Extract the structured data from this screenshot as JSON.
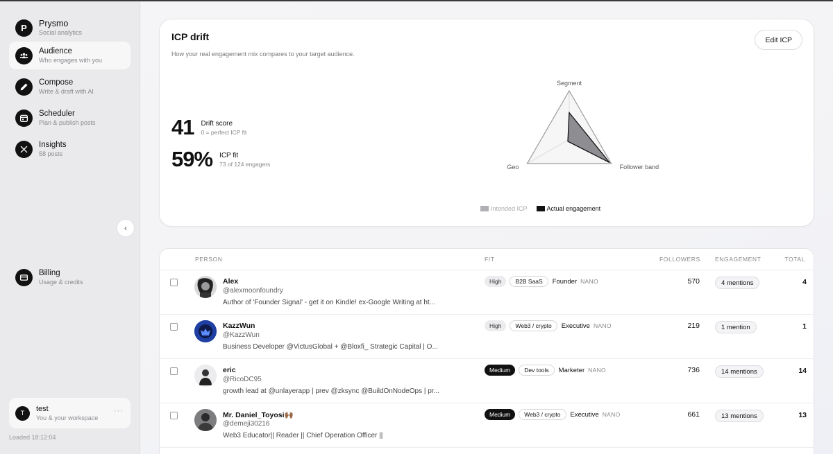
{
  "brand": {
    "name": "Prysmo",
    "tagline": "Social analytics",
    "initial": "P"
  },
  "nav": [
    {
      "title": "Audience",
      "sub": "Who engages with you",
      "icon": "people-icon",
      "active": true
    },
    {
      "title": "Compose",
      "sub": "Write & draft with AI",
      "icon": "pen-icon"
    },
    {
      "title": "Scheduler",
      "sub": "Plan & publish posts",
      "icon": "calendar-icon"
    },
    {
      "title": "Insights",
      "sub": "58 posts",
      "icon": "x-logo-icon"
    }
  ],
  "billing": {
    "title": "Billing",
    "sub": "Usage & credits",
    "icon": "card-icon"
  },
  "user": {
    "initial": "T",
    "name": "test",
    "sub": "You & your workspace",
    "more": "···"
  },
  "loaded": "Loaded 18:12:04",
  "collapse_glyph": "‹",
  "icp": {
    "title": "ICP drift",
    "description": "How your real engagement mix compares to your target audience.",
    "edit_label": "Edit ICP",
    "drift": {
      "value": "41",
      "label": "Drift score",
      "sub": "0 = perfect ICP fit"
    },
    "fit": {
      "value": "59%",
      "label": "ICP fit",
      "sub": "73 of 124 engagers"
    }
  },
  "chart_data": {
    "type": "radar",
    "axes": [
      "Segment",
      "Follower band",
      "Geo"
    ],
    "series": [
      {
        "name": "Intended ICP",
        "values": [
          1.0,
          1.0,
          1.0
        ],
        "color": "#b0b0b4"
      },
      {
        "name": "Actual engagement",
        "values": [
          0.55,
          0.96,
          0.0
        ],
        "color": "#111111"
      }
    ],
    "range": [
      0,
      1
    ],
    "rings": 4
  },
  "table": {
    "headers": {
      "person": "PERSON",
      "fit": "FIT",
      "followers": "FOLLOWERS",
      "engagement": "ENGAGEMENT",
      "total": "TOTAL"
    },
    "rows": [
      {
        "name": "Alex",
        "handle": "@alexmoonfoundry",
        "bio": "Author of 'Founder Signal' - get it on Kindle! ex-Google Writing at ht...",
        "level": "High",
        "industry": "B2B SaaS",
        "role": "Founder",
        "tier": "NANO",
        "followers": "570",
        "mentions": "4 mentions",
        "total": "4"
      },
      {
        "name": "KazzWun",
        "handle": "@KazzWun",
        "bio": "Business Developer @VictusGlobal + @Bloxfi_ Strategic Capital | O...",
        "level": "High",
        "industry": "Web3 / crypto",
        "role": "Executive",
        "tier": "NANO",
        "followers": "219",
        "mentions": "1 mention",
        "total": "1"
      },
      {
        "name": "eric",
        "handle": "@RicoDC95",
        "bio": "growth lead at @unlayerapp | prev @zksync @BuildOnNodeOps | pr...",
        "level": "Medium",
        "industry": "Dev tools",
        "role": "Marketer",
        "tier": "NANO",
        "followers": "736",
        "mentions": "14 mentions",
        "total": "14"
      },
      {
        "name": "Mr. Daniel_Toyosi🙌🏾",
        "handle": "@demeji30216",
        "bio": "Web3 Educator|| Reader || Chief Operation Officer ||",
        "level": "Medium",
        "industry": "Web3 / crypto",
        "role": "Executive",
        "tier": "NANO",
        "followers": "661",
        "mentions": "13 mentions",
        "total": "13"
      }
    ]
  }
}
